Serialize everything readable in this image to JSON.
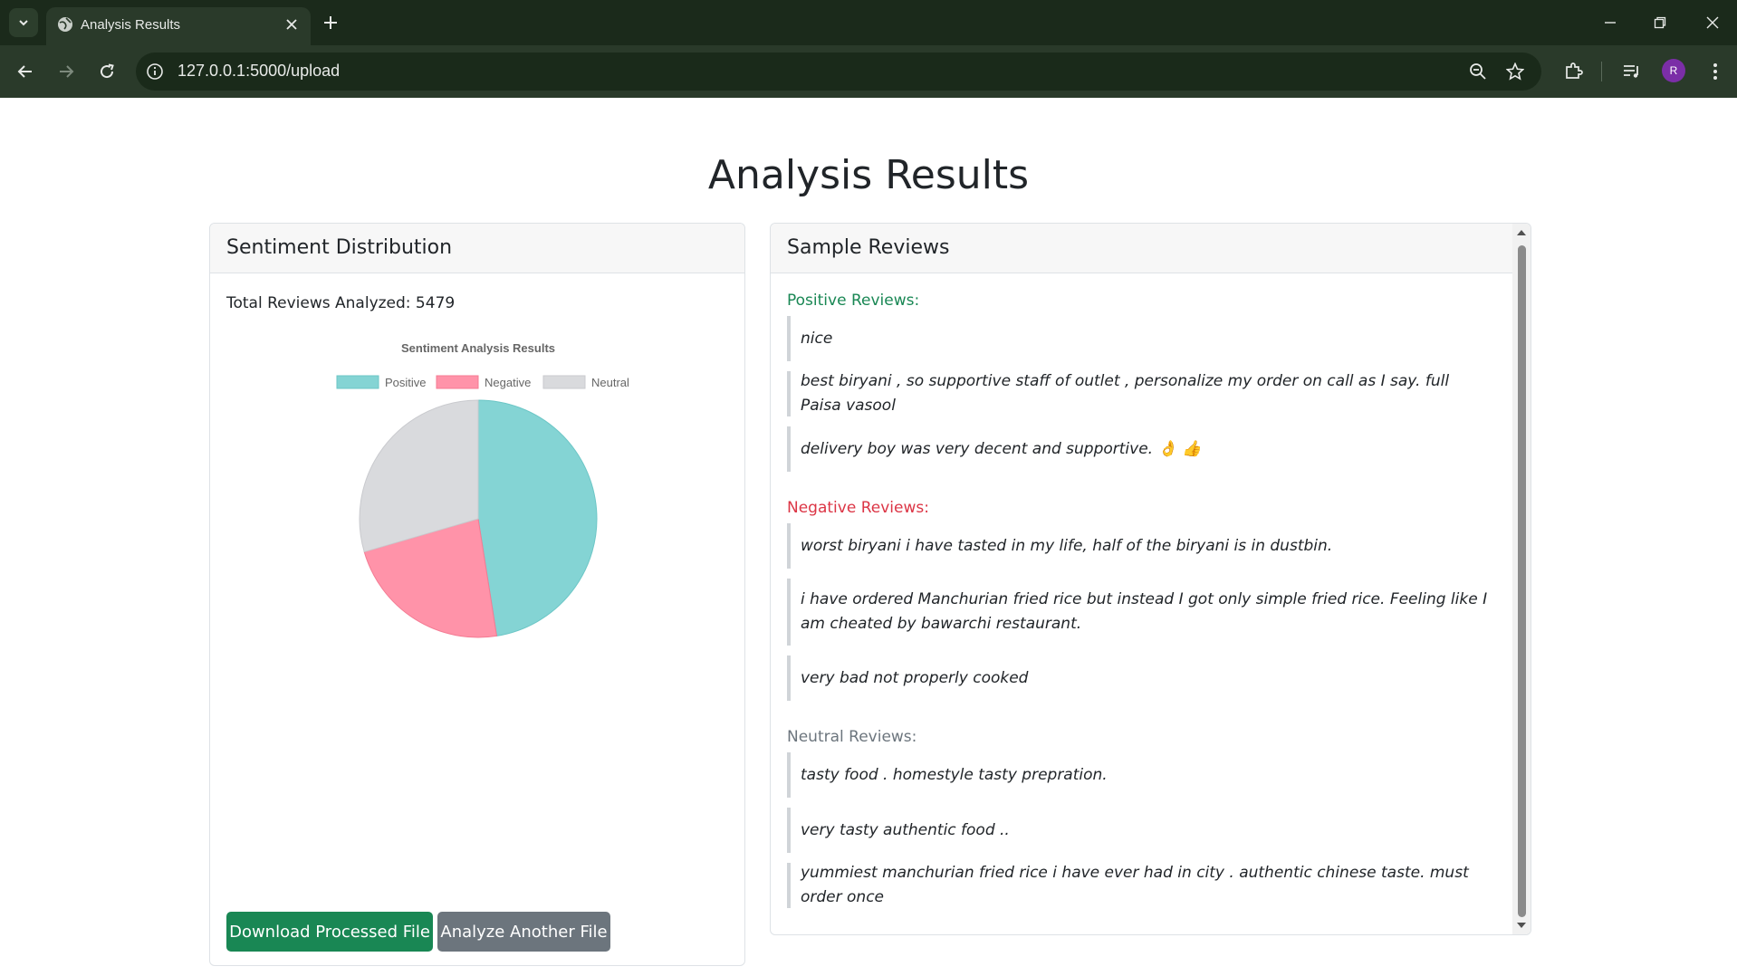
{
  "browser": {
    "tab_title": "Analysis Results",
    "url": "127.0.0.1:5000/upload",
    "profile_initial": "R"
  },
  "page": {
    "title": "Analysis Results"
  },
  "distribution": {
    "header": "Sentiment Distribution",
    "total_text": "Total Reviews Analyzed: 5479",
    "download_label": "Download Processed File",
    "analyze_label": "Analyze Another File"
  },
  "chart_data": {
    "type": "pie",
    "title": "Sentiment Analysis Results",
    "legend_position": "top",
    "categories": [
      "Positive",
      "Negative",
      "Neutral"
    ],
    "values": [
      47.5,
      23.0,
      29.5
    ],
    "colors": [
      "#84d4d4",
      "#ff93a9",
      "#d9dadd"
    ],
    "borders": [
      "#6cc6c6",
      "#f47b93",
      "#c9cace"
    ]
  },
  "reviews": {
    "header": "Sample Reviews",
    "positive_title": "Positive Reviews:",
    "negative_title": "Negative Reviews:",
    "neutral_title": "Neutral Reviews:",
    "positive": [
      "nice",
      "best biryani , so supportive staff of outlet , personalize my order on call as I say. full Paisa vasool",
      "delivery boy was very decent and supportive. 👌 👍"
    ],
    "negative": [
      "worst biryani i have tasted in my life, half of the biryani is in dustbin.",
      "i have ordered Manchurian fried rice but instead I got only simple fried rice. Feeling like I am cheated by bawarchi restaurant.",
      "very bad not properly cooked"
    ],
    "neutral": [
      "tasty food . homestyle tasty prepration.",
      "very tasty authentic food ..",
      "yummiest manchurian fried rice i have ever had in city . authentic chinese taste. must order once"
    ],
    "colors": {
      "positive": "#198754",
      "negative": "#dc3545",
      "neutral": "#6c757d"
    }
  }
}
